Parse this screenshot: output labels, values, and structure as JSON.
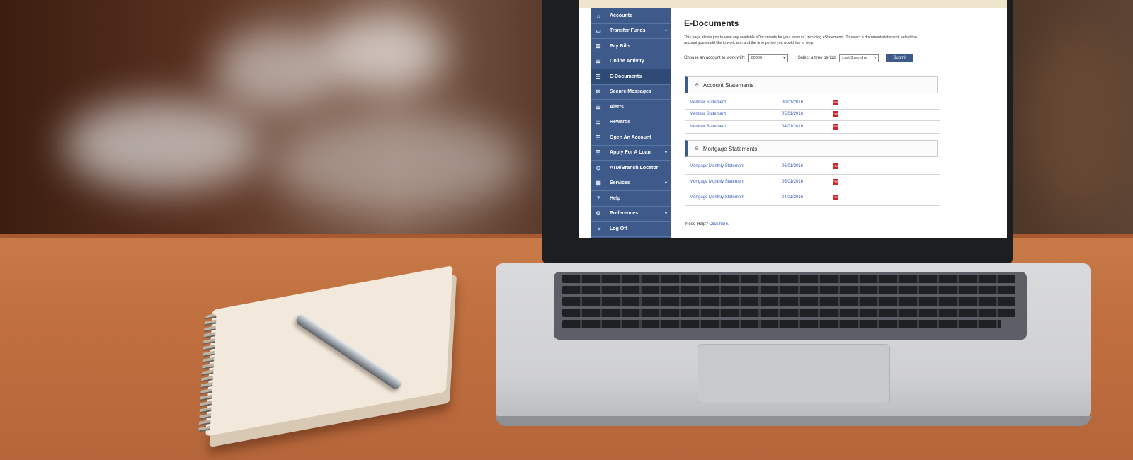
{
  "sidebar": {
    "items": [
      {
        "label": "Accounts",
        "icon": "home-icon",
        "glyph": "⌂",
        "caret": false
      },
      {
        "label": "Transfer Funds",
        "icon": "card-icon",
        "glyph": "▭",
        "caret": true
      },
      {
        "label": "Pay Bills",
        "icon": "menu-icon",
        "glyph": "☰",
        "caret": false
      },
      {
        "label": "Online Activity",
        "icon": "menu-icon",
        "glyph": "☰",
        "caret": false
      },
      {
        "label": "E-Documents",
        "icon": "menu-icon",
        "glyph": "☰",
        "caret": false,
        "active": true
      },
      {
        "label": "Secure Messages",
        "icon": "envelope-icon",
        "glyph": "✉",
        "caret": false
      },
      {
        "label": "Alerts",
        "icon": "menu-icon",
        "glyph": "☰",
        "caret": false
      },
      {
        "label": "Rewards",
        "icon": "menu-icon",
        "glyph": "☰",
        "caret": false
      },
      {
        "label": "Open An Account",
        "icon": "menu-icon",
        "glyph": "☰",
        "caret": false
      },
      {
        "label": "Apply For A Loan",
        "icon": "menu-icon",
        "glyph": "☰",
        "caret": true
      },
      {
        "label": "ATM/Branch Locator",
        "icon": "location-pin-icon",
        "glyph": "⊙",
        "caret": false
      },
      {
        "label": "Services",
        "icon": "calendar-icon",
        "glyph": "▦",
        "caret": true
      },
      {
        "label": "Help",
        "icon": "help-icon",
        "glyph": "?",
        "caret": false
      },
      {
        "label": "Preferences",
        "icon": "gear-icon",
        "glyph": "⚙",
        "caret": true
      },
      {
        "label": "Log Off",
        "icon": "logout-icon",
        "glyph": "⇥",
        "caret": false
      }
    ]
  },
  "main": {
    "title": "E-Documents",
    "intro": "This page allows you to view any available eDocuments for your account, including eStatements. To select a document/statement, select the account you would like to work with and the time period you would like to view.",
    "account_label": "Choose an account to work with:",
    "account_value": "00000",
    "period_label": "Select a time period:",
    "period_value": "Last 3 months",
    "submit_label": "Submit",
    "sections": [
      {
        "title": "Account Statements",
        "rows": [
          {
            "name": "Member Statement",
            "date": "00/01/2016"
          },
          {
            "name": "Member Statement",
            "date": "05/01/2016"
          },
          {
            "name": "Member Statement",
            "date": "04/01/2016"
          }
        ]
      },
      {
        "title": "Mortgage Statements",
        "rows": [
          {
            "name": "Mortgage Monthly Statement",
            "date": "06/01/2016"
          },
          {
            "name": "Mortgage Monthly Statement",
            "date": "05/01/2016"
          },
          {
            "name": "Mortgage Monthly Statement",
            "date": "04/01/2016"
          }
        ]
      }
    ],
    "help_text": "Need Help?",
    "help_link": "Click here."
  },
  "colors": {
    "sidebar": "#3d5a8a",
    "link": "#3558b8",
    "pdf": "#c8262a"
  }
}
